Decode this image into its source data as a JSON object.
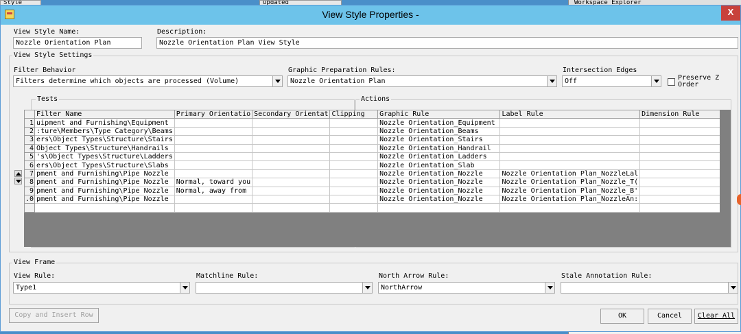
{
  "background": {
    "left_label": "Style",
    "center_label": "Updated",
    "right_label": "Workspace Explorer"
  },
  "window": {
    "title": "View Style Properties -",
    "close_label": "X"
  },
  "header": {
    "name_label": "View Style Name:",
    "name_value": "Nozzle Orientation Plan",
    "description_label": "Description:",
    "description_value": "Nozzle Orientation Plan View Style"
  },
  "settings": {
    "group_title": "View Style Settings",
    "filter_behavior_label": "Filter Behavior",
    "filter_behavior_value": "Filters determine which objects are processed (Volume)",
    "graphic_prep_label": "Graphic Preparation Rules:",
    "graphic_prep_value": "Nozzle Orientation Plan",
    "intersection_label": "Intersection Edges",
    "intersection_value": "Off",
    "preserve_z_label_1": "Preserve Z",
    "preserve_z_label_2": "Order",
    "preserve_z_checked": false
  },
  "grid": {
    "tests_title": "Tests",
    "actions_title": "Actions",
    "columns": [
      "Filter Name",
      "Primary Orientatio",
      "Secondary Orientat",
      "Clipping",
      "Graphic Rule",
      "Label Rule",
      "Dimension Rule"
    ],
    "rows": [
      {
        "num": "1",
        "cells": [
          "uipment and Furnishing\\Equipment",
          "",
          "",
          "",
          "Nozzle Orientation_Equipment",
          "",
          ""
        ]
      },
      {
        "num": "2",
        "cells": [
          ":ture\\Members\\Type Category\\Beams",
          "",
          "",
          "",
          "Nozzle Orientation_Beams",
          "",
          ""
        ]
      },
      {
        "num": "3",
        "cells": [
          "ers\\Object Types\\Structure\\Stairs",
          "",
          "",
          "",
          "Nozzle Orientation_Stairs",
          "",
          ""
        ]
      },
      {
        "num": "4",
        "cells": [
          "Object Types\\Structure\\Handrails",
          "",
          "",
          "",
          "Nozzle Orientation_Handrail",
          "",
          ""
        ]
      },
      {
        "num": "5",
        "cells": [
          "'s\\Object Types\\Structure\\Ladders",
          "",
          "",
          "",
          "Nozzle Orientation_Ladders",
          "",
          ""
        ]
      },
      {
        "num": "6",
        "cells": [
          "ers\\Object Types\\Structure\\Slabs",
          "",
          "",
          "",
          "Nozzle Orientation_Slab",
          "",
          ""
        ]
      },
      {
        "num": "7",
        "cells": [
          "pment and Furnishing\\Pipe Nozzle",
          "",
          "",
          "",
          "Nozzle Orientation_Nozzle",
          "Nozzle Orientation Plan_NozzleLal",
          ""
        ]
      },
      {
        "num": "8",
        "cells": [
          "pment and Furnishing\\Pipe Nozzle",
          "Normal, toward you",
          "",
          "",
          "Nozzle Orientation_Nozzle",
          "Nozzle Orientation Plan_Nozzle_T(",
          ""
        ]
      },
      {
        "num": "9",
        "cells": [
          "pment and Furnishing\\Pipe Nozzle",
          "Normal, away from",
          "",
          "",
          "Nozzle Orientation_Nozzle",
          "Nozzle Orientation Plan_Nozzle_B'",
          ""
        ]
      },
      {
        "num": ".0",
        "cells": [
          "pment and Furnishing\\Pipe Nozzle",
          "",
          "",
          "",
          "Nozzle Orientation_Nozzle",
          "Nozzle Orientation Plan_NozzleAn:",
          ""
        ]
      },
      {
        "num": "",
        "cells": [
          "",
          "",
          "",
          "",
          "",
          "",
          ""
        ]
      }
    ]
  },
  "view_frame": {
    "group_title": "View Frame",
    "view_rule_label": "View Rule:",
    "view_rule_value": "Type1",
    "matchline_label": "Matchline Rule:",
    "matchline_value": "",
    "north_arrow_label": "North Arrow Rule:",
    "north_arrow_value": "NorthArrow",
    "stale_label": "Stale Annotation Rule:",
    "stale_value": ""
  },
  "buttons": {
    "copy_insert": "Copy and Insert Row",
    "ok": "OK",
    "cancel": "Cancel",
    "clear_all": "Clear All"
  },
  "colors": {
    "titlebar": "#6dc3ea",
    "close": "#c8413b",
    "dialog": "#f0f0f0",
    "grid_empty": "#808080"
  }
}
